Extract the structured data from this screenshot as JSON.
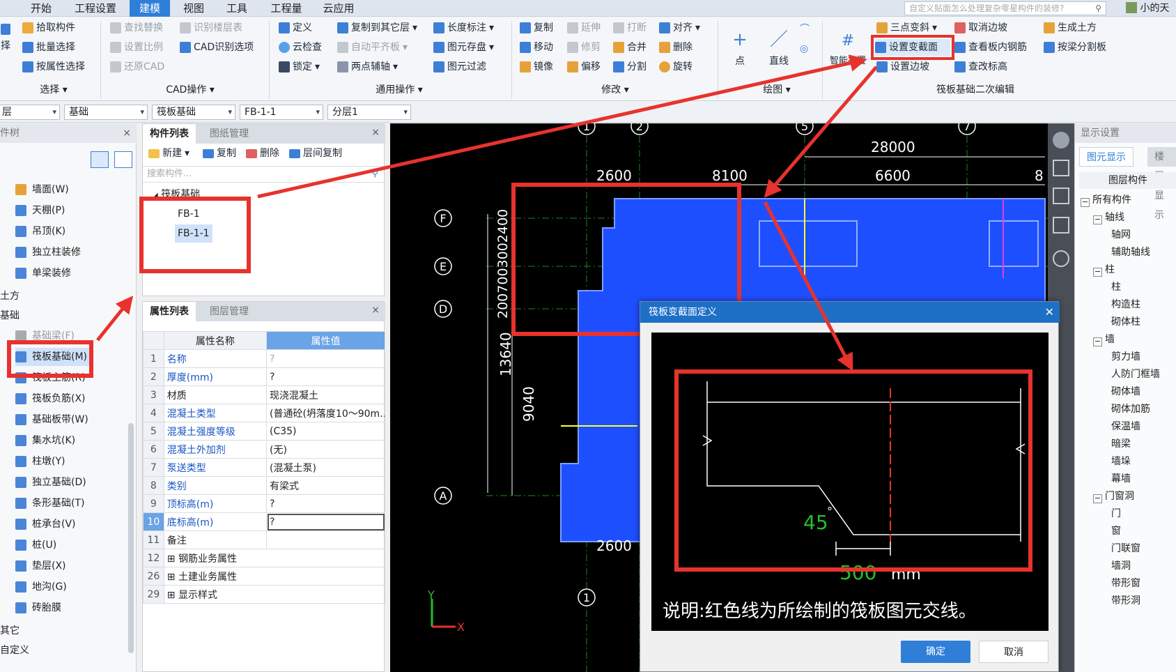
{
  "menubar": {
    "tabs": [
      {
        "label": "开始"
      },
      {
        "label": "工程设置"
      },
      {
        "label": "建模"
      },
      {
        "label": "视图"
      },
      {
        "label": "工具"
      },
      {
        "label": "工程量"
      },
      {
        "label": "云应用"
      }
    ],
    "active_index": 2,
    "search_placeholder": "自定义贴面怎么处理复杂零星构件的装修?",
    "user": "小的天"
  },
  "ribbon": {
    "select": {
      "pick": "拾取构件",
      "batch": "批量选择",
      "by_attr": "按属性选择",
      "group": "选择",
      "left_cut": "择"
    },
    "cad": {
      "find_replace": "查找替换",
      "set_scale": "设置比例",
      "restore_cad": "还原CAD",
      "recognize_floor": "识别楼层表",
      "cad_options": "CAD识别选项",
      "group": "CAD操作"
    },
    "common": {
      "define": "定义",
      "cloud_check": "云检查",
      "lock": "锁定",
      "copy_to_floor": "复制到其它层",
      "auto_align": "自动平齐板",
      "two_point_axis": "两点辅轴",
      "length_dim": "长度标注",
      "elem_store": "图元存盘",
      "elem_filter": "图元过滤",
      "group": "通用操作"
    },
    "modify": {
      "copy": "复制",
      "move": "移动",
      "mirror": "镜像",
      "extend": "延伸",
      "trim": "修剪",
      "offset": "偏移",
      "break": "打断",
      "merge": "合并",
      "split": "分割",
      "align": "对齐",
      "delete": "删除",
      "rotate": "旋转",
      "group": "修改"
    },
    "draw": {
      "point": "点",
      "line": "直线",
      "group": "绘图"
    },
    "raft": {
      "smart_layout": "智能布置",
      "three_point_slope": "三点变斜",
      "set_var_section": "设置变截面",
      "set_edge_slope": "设置边坡",
      "cancel_edge_slope": "取消边坡",
      "view_rebar": "查看板内钢筋",
      "check_elev": "查改标高",
      "gen_earth": "生成土方",
      "split_by_beam": "按梁分割板",
      "group": "筏板基础二次编辑"
    }
  },
  "selbar": {
    "floor": "层",
    "type": "基础",
    "element": "筏板基础",
    "name": "FB-1-1",
    "layer": "分层1"
  },
  "navpanel": {
    "title": "构件树",
    "items": [
      {
        "label": "墙面(W)"
      },
      {
        "label": "天棚(P)"
      },
      {
        "label": "吊顶(K)"
      },
      {
        "label": "独立柱装修"
      },
      {
        "label": "单梁装修"
      }
    ],
    "section_earth": "土方",
    "section_foundation": "基础",
    "found_items": [
      {
        "label": "基础梁(F)"
      },
      {
        "label": "筏板基础(M)"
      },
      {
        "label": "筏板主筋(R)"
      },
      {
        "label": "筏板负筋(X)"
      },
      {
        "label": "基础板带(W)"
      },
      {
        "label": "集水坑(K)"
      },
      {
        "label": "柱墩(Y)"
      },
      {
        "label": "独立基础(D)"
      },
      {
        "label": "条形基础(T)"
      },
      {
        "label": "桩承台(V)"
      },
      {
        "label": "桩(U)"
      },
      {
        "label": "垫层(X)"
      },
      {
        "label": "地沟(G)"
      },
      {
        "label": "砖胎膜"
      }
    ],
    "section_other": "其它",
    "section_custom": "自定义"
  },
  "complist": {
    "tab_on": "构件列表",
    "tab_off": "图纸管理",
    "new": "新建",
    "copy": "复制",
    "delete": "删除",
    "floor_copy": "层间复制",
    "search_placeholder": "搜索构件...",
    "root": "筏板基础",
    "children": [
      "FB-1",
      "FB-1-1"
    ],
    "selected": "FB-1-1"
  },
  "proplist": {
    "tab_on": "属性列表",
    "tab_off": "图层管理",
    "col_name": "属性名称",
    "col_value": "属性值",
    "rows": [
      {
        "n": "1",
        "k": "名称",
        "v": "?"
      },
      {
        "n": "2",
        "k": "厚度(mm)",
        "v": "?"
      },
      {
        "n": "3",
        "k": "材质",
        "v": "现浇混凝土"
      },
      {
        "n": "4",
        "k": "混凝土类型",
        "v": "(普通砼(坍落度10～90m..."
      },
      {
        "n": "5",
        "k": "混凝土强度等级",
        "v": "(C35)"
      },
      {
        "n": "6",
        "k": "混凝土外加剂",
        "v": "(无)"
      },
      {
        "n": "7",
        "k": "泵送类型",
        "v": "(混凝土泵)"
      },
      {
        "n": "8",
        "k": "类别",
        "v": "有梁式"
      },
      {
        "n": "9",
        "k": "顶标高(m)",
        "v": "?"
      },
      {
        "n": "10",
        "k": "底标高(m)",
        "v": "?"
      },
      {
        "n": "11",
        "k": "备注",
        "v": ""
      },
      {
        "n": "12",
        "k": "钢筋业务属性",
        "v": ""
      },
      {
        "n": "26",
        "k": "土建业务属性",
        "v": ""
      },
      {
        "n": "29",
        "k": "显示样式",
        "v": ""
      }
    ]
  },
  "canvas": {
    "axis_top": [
      "1",
      "2",
      "5",
      "7"
    ],
    "axis_left": [
      "F",
      "E",
      "D",
      "A"
    ],
    "axis_bottom": [
      "1"
    ],
    "dim_top_total": "28000",
    "dim_top": [
      "2600",
      "8100",
      "6600",
      "8"
    ],
    "dim_left_stack": "2007003002400",
    "dim_13640": "13640",
    "dim_9040": "9040",
    "dim_bottom": "2600",
    "ucs_x": "X",
    "ucs_y": "Y"
  },
  "dialog": {
    "title": "筏板变截面定义",
    "angle": "45",
    "degree": "°",
    "offset_value": "500",
    "unit": "mm",
    "note": "说明:红色线为所绘制的筏板图元交线。",
    "ok": "确定",
    "cancel": "取消"
  },
  "display": {
    "title": "显示设置",
    "tab_on": "图元显示",
    "tab_off": "楼层显示",
    "header": "图层构件",
    "items": [
      {
        "label": "所有构件",
        "level": 0,
        "exp": "-"
      },
      {
        "label": "轴线",
        "level": 1,
        "exp": "-"
      },
      {
        "label": "轴网",
        "level": 2
      },
      {
        "label": "辅助轴线",
        "level": 2
      },
      {
        "label": "柱",
        "level": 1,
        "exp": "-"
      },
      {
        "label": "柱",
        "level": 2
      },
      {
        "label": "构造柱",
        "level": 2
      },
      {
        "label": "砌体柱",
        "level": 2
      },
      {
        "label": "墙",
        "level": 1,
        "exp": "-"
      },
      {
        "label": "剪力墙",
        "level": 2
      },
      {
        "label": "人防门框墙",
        "level": 2
      },
      {
        "label": "砌体墙",
        "level": 2
      },
      {
        "label": "砌体加筋",
        "level": 2
      },
      {
        "label": "保温墙",
        "level": 2
      },
      {
        "label": "暗梁",
        "level": 2
      },
      {
        "label": "墙垛",
        "level": 2
      },
      {
        "label": "幕墙",
        "level": 2
      },
      {
        "label": "门窗洞",
        "level": 1,
        "exp": "-"
      },
      {
        "label": "门",
        "level": 2
      },
      {
        "label": "窗",
        "level": 2
      },
      {
        "label": "门联窗",
        "level": 2
      },
      {
        "label": "墙洞",
        "level": 2
      },
      {
        "label": "带形窗",
        "level": 2
      },
      {
        "label": "带形洞",
        "level": 2
      }
    ]
  },
  "colors": {
    "accent": "#2f7fd8",
    "highlight": "#e8322d",
    "slab": "#1e4fff",
    "cad_green": "#22c322",
    "dim_white": "#ffffff"
  }
}
